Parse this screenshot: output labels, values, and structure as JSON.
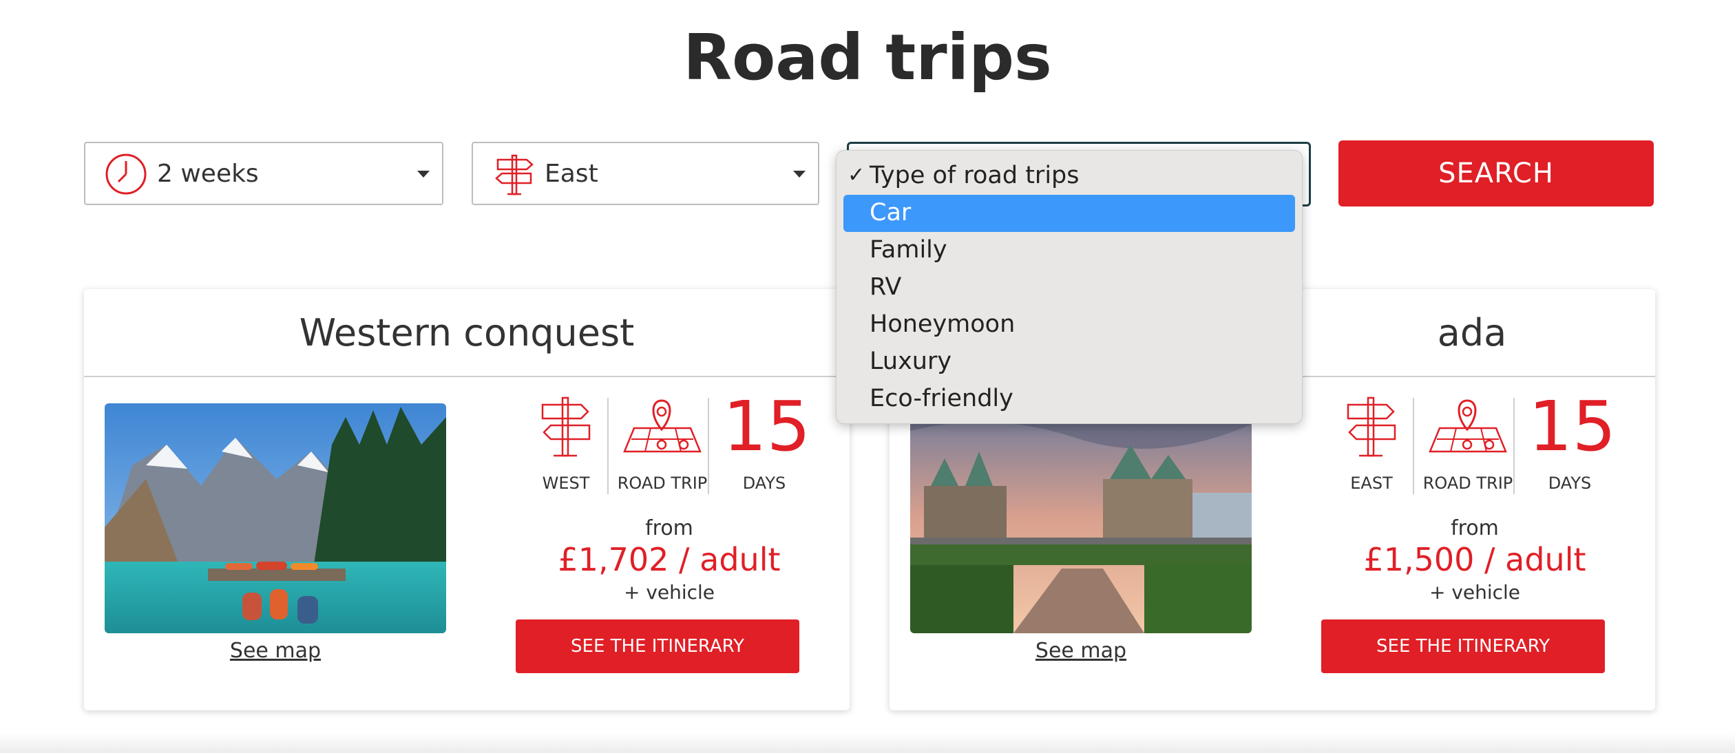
{
  "page": {
    "title": "Road trips"
  },
  "filters": {
    "duration": {
      "value": "2 weeks",
      "icon": "clock-icon"
    },
    "region": {
      "value": "East",
      "icon": "signpost-icon"
    },
    "type": {
      "placeholder": "Type of road trips",
      "selected": "Car"
    },
    "search_label": "SEARCH"
  },
  "dropdown": {
    "checked_item": "Type of road trips",
    "options": [
      "Car",
      "Family",
      "RV",
      "Honeymoon",
      "Luxury",
      "Eco-friendly"
    ],
    "highlighted_index": 0
  },
  "cards": [
    {
      "title": "Western conquest",
      "region": "WEST",
      "type": "ROAD TRIP",
      "days": "15",
      "days_label": "DAYS",
      "from_label": "from",
      "price": "£1,702 / adult",
      "extra": "+ vehicle",
      "button": "SEE THE ITINERARY",
      "see_map": "See map"
    },
    {
      "title": "ada",
      "region": "EAST",
      "type": "ROAD TRIP",
      "days": "15",
      "days_label": "DAYS",
      "from_label": "from",
      "price": "£1,500 / adult",
      "extra": "+ vehicle",
      "button": "SEE THE ITINERARY",
      "see_map": "See map"
    }
  ],
  "colors": {
    "accent": "#e01f26",
    "highlight": "#3d98fb",
    "dropdown_bg": "#e9e7e5"
  }
}
